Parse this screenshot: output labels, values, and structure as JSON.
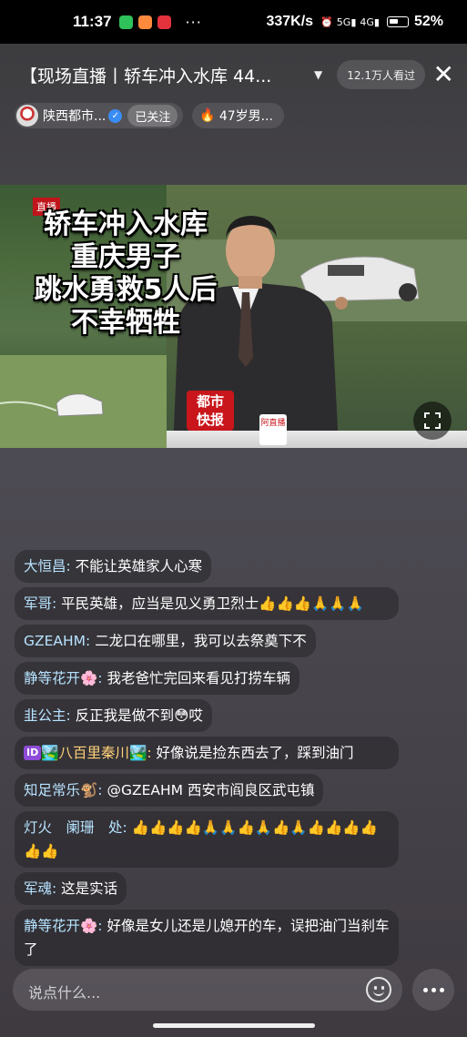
{
  "status_bar": {
    "time": "11:37",
    "dots": "···",
    "speed": "337K/s",
    "battery": "52%",
    "net_5g": "5G",
    "net_4g": "4G"
  },
  "room": {
    "title": "【现场直播丨轿车冲入水库 44...",
    "viewers": "12.1万人看过"
  },
  "host": {
    "name": "陕西都市...",
    "follow_label": "已关注",
    "topic": "47岁男..."
  },
  "video": {
    "headline": [
      "轿车冲入水库",
      "重庆男子",
      "跳水勇救5人后",
      "不幸牺牲"
    ],
    "logo_top": "直播",
    "desk_logo": [
      "都市",
      "快报"
    ],
    "desk_logo2": "阿直播"
  },
  "comments": [
    {
      "user": "大恒昌:",
      "text": " 不能让英雄家人心寒"
    },
    {
      "user": "军哥:",
      "text": " 平民英雄，应当是见义勇卫烈士👍👍👍🙏🙏🙏"
    },
    {
      "user": "GZEAHM:",
      "text": " 二龙口在哪里，我可以去祭奠下不"
    },
    {
      "user": "静等花开🌸:",
      "text": " 我老爸忙完回来看见打捞车辆"
    },
    {
      "user": "韭公主:",
      "text": " 反正我是做不到😳哎"
    },
    {
      "badge": "ID",
      "user": "🏞️八百里秦川🏞️:",
      "text": " 好像说是捡东西去了，踩到油门"
    },
    {
      "user": "知足常乐🐒:",
      "text": " @GZEAHM 西安市阎良区武屯镇"
    },
    {
      "user": "灯火　阑珊　处:",
      "text": " 👍👍👍👍🙏🙏👍🙏👍🙏👍👍👍👍👍👍"
    },
    {
      "user": "军魂:",
      "text": " 这是实话"
    },
    {
      "user": "静等花开🌸:",
      "text": " 好像是女儿还是儿媳开的车，误把油门当刹车了"
    }
  ],
  "input": {
    "placeholder": "说点什么..."
  }
}
